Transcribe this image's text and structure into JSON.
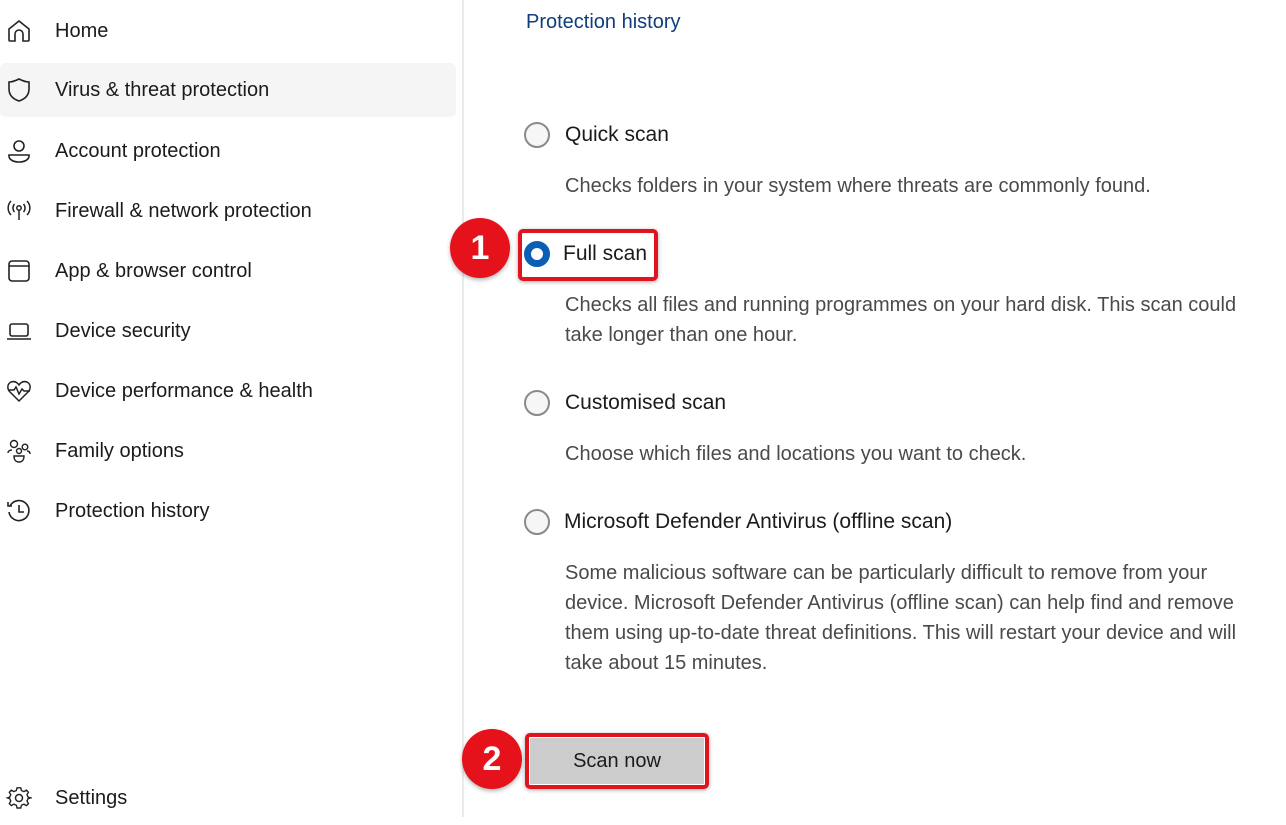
{
  "sidebar": {
    "items": [
      {
        "label": "Home",
        "icon": "home-icon"
      },
      {
        "label": "Virus & threat protection",
        "icon": "shield-icon",
        "active": true
      },
      {
        "label": "Account protection",
        "icon": "person-icon"
      },
      {
        "label": "Firewall & network protection",
        "icon": "antenna-icon"
      },
      {
        "label": "App & browser control",
        "icon": "browser-window-icon"
      },
      {
        "label": "Device security",
        "icon": "laptop-icon"
      },
      {
        "label": "Device performance & health",
        "icon": "heart-pulse-icon"
      },
      {
        "label": "Family options",
        "icon": "family-icon"
      },
      {
        "label": "Protection history",
        "icon": "history-icon"
      }
    ],
    "settings": {
      "label": "Settings",
      "icon": "gear-icon"
    }
  },
  "main": {
    "protection_history_link": "Protection history",
    "scan_options": [
      {
        "label": "Quick scan",
        "description": "Checks folders in your system where threats are commonly found.",
        "selected": false
      },
      {
        "label": "Full scan",
        "description": "Checks all files and running programmes on your hard disk. This scan could take longer than one hour.",
        "selected": true
      },
      {
        "label": "Customised scan",
        "description": "Choose which files and locations you want to check.",
        "selected": false
      },
      {
        "label": "Microsoft Defender Antivirus (offline scan)",
        "description": "Some malicious software can be particularly difficult to remove from your device. Microsoft Defender Antivirus (offline scan) can help find and remove them using up-to-date threat definitions. This will restart your device and will take about 15 minutes.",
        "selected": false
      }
    ],
    "scan_now_label": "Scan now"
  },
  "annotations": {
    "step1": "1",
    "step2": "2",
    "highlight_color": "#e0141e"
  },
  "colors": {
    "accent": "#0a5fb4",
    "link": "#0f3e7a",
    "active_nav_bg": "#f5f5f5",
    "button_bg": "#cccccc"
  }
}
